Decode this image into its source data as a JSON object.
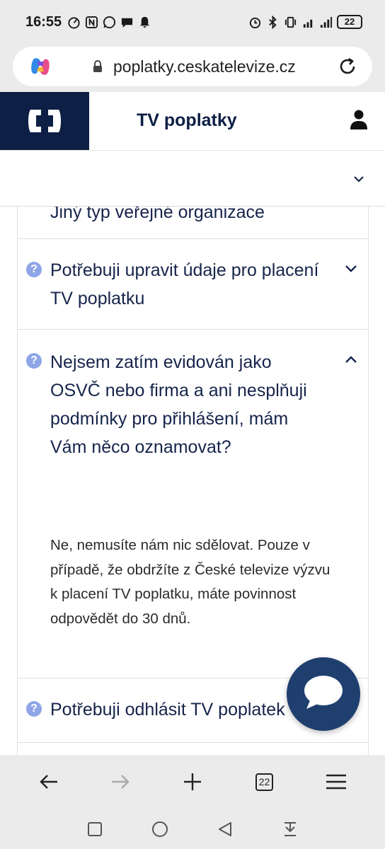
{
  "status_bar": {
    "time": "16:55",
    "battery": "22"
  },
  "browser": {
    "url": "poplatky.ceskatelevize.cz",
    "tab_count": "22"
  },
  "site": {
    "title": "TV poplatky"
  },
  "faq": {
    "cut_item": "Jiný typ veřejné organizace",
    "items": [
      {
        "question": "Potřebuji upravit údaje pro placení TV poplatku",
        "expanded": false
      },
      {
        "question": "Nejsem zatím evidován jako OSVČ nebo firma a ani nesplňuji podmínky pro přihlášení, mám Vám něco oznamovat?",
        "expanded": true,
        "answer": "Ne, nemusíte nám nic sdělovat. Pouze v případě, že obdržíte z České televize výzvu k placení TV poplatku, máte povinnost odpovědět do 30 dnů."
      },
      {
        "question": "Potřebuji odhlásit TV poplatek",
        "expanded": false
      }
    ]
  },
  "colors": {
    "brand_navy": "#0d1f44",
    "question_icon": "#8ea6e6",
    "chat_button": "#1f3f6f"
  },
  "icons": {
    "copilot": "copilot-icon",
    "lock": "lock-icon",
    "reload": "reload-icon",
    "user": "user-icon",
    "chat": "chat-bubble-icon"
  }
}
